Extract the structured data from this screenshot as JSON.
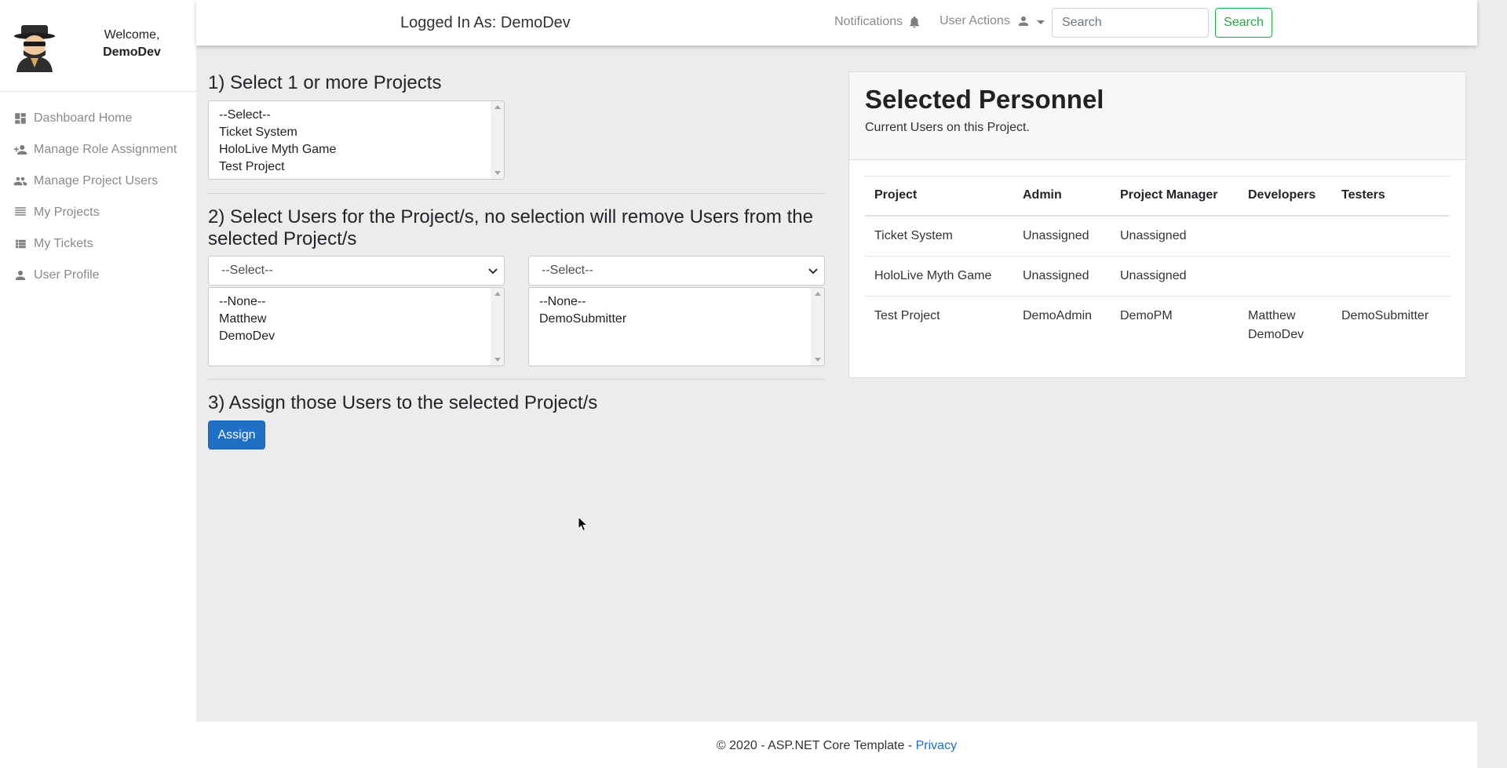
{
  "sidebar": {
    "welcome_label": "Welcome,",
    "username": "DemoDev",
    "items": [
      {
        "label": "Dashboard Home",
        "icon": "dashboard-icon"
      },
      {
        "label": "Manage Role Assignment",
        "icon": "person-add-icon"
      },
      {
        "label": "Manage Project Users",
        "icon": "people-icon"
      },
      {
        "label": "My Projects",
        "icon": "list-icon"
      },
      {
        "label": "My Tickets",
        "icon": "list-alt-icon"
      },
      {
        "label": "User Profile",
        "icon": "person-icon"
      }
    ]
  },
  "topbar": {
    "logged_in": "Logged In As: DemoDev",
    "notifications_label": "Notifications",
    "user_actions_label": "User Actions",
    "search_placeholder": "Search",
    "search_button": "Search"
  },
  "steps": {
    "step1_title": "1) Select 1 or more Projects",
    "projects_options": [
      "--Select--",
      "Ticket System",
      "HoloLive Myth Game",
      "Test Project"
    ],
    "step2_title": "2) Select Users for the Project/s, no selection will remove Users from the selected Project/s",
    "left_dropdown": "--Select--",
    "left_users": [
      "--None--",
      "Matthew",
      "DemoDev"
    ],
    "right_dropdown": "--Select--",
    "right_users": [
      "--None--",
      "DemoSubmitter"
    ],
    "step3_title": "3) Assign those Users to the selected Project/s",
    "assign_button": "Assign"
  },
  "personnel": {
    "title": "Selected Personnel",
    "subtitle": "Current Users on this Project.",
    "headers": [
      "Project",
      "Admin",
      "Project Manager",
      "Developers",
      "Testers"
    ],
    "rows": [
      {
        "project": "Ticket System",
        "admin": "Unassigned",
        "pm": "Unassigned",
        "dev1": "",
        "dev2": "",
        "testers": ""
      },
      {
        "project": "HoloLive Myth Game",
        "admin": "Unassigned",
        "pm": "Unassigned",
        "dev1": "",
        "dev2": "",
        "testers": ""
      },
      {
        "project": "Test Project",
        "admin": "DemoAdmin",
        "pm": "DemoPM",
        "dev1": "Matthew",
        "dev2": "DemoDev",
        "testers": "DemoSubmitter"
      }
    ]
  },
  "footer": {
    "text": "© 2020 - ASP.NET Core Template - ",
    "privacy_link": "Privacy"
  },
  "colors": {
    "accent_blue": "#1f6fc5",
    "search_green": "#28a745",
    "background": "#ececec"
  }
}
